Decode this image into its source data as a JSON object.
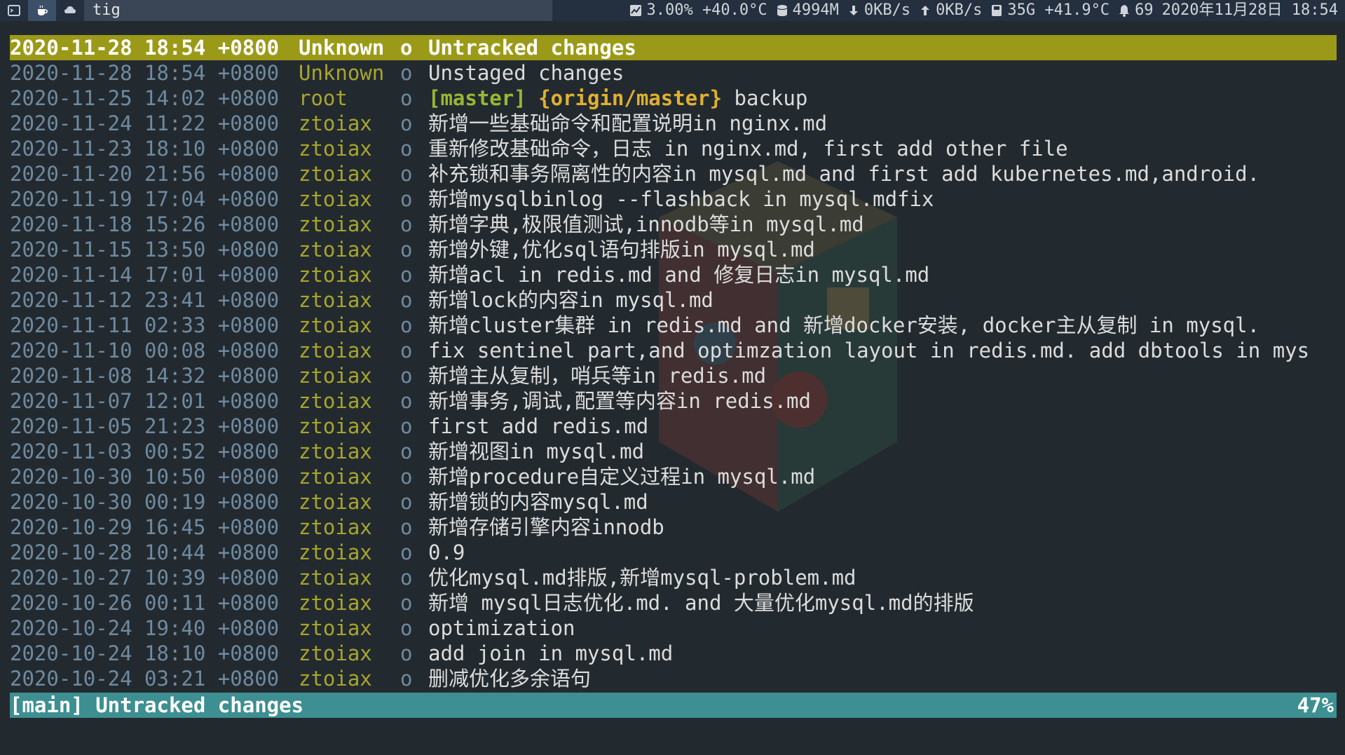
{
  "topbar": {
    "workspaces": [
      {
        "icon": "terminal-icon",
        "active": false
      },
      {
        "icon": "coffee-icon",
        "active": true
      },
      {
        "icon": "cloud-icon",
        "active": false
      }
    ],
    "window_title": "tig",
    "cpu": "3.00% +40.0°C",
    "memory": "4994M",
    "download": "0KB/s",
    "upload": "0KB/s",
    "disk": "35G +41.9°C",
    "notifications": "69",
    "datetime": "2020年11月28日 18:54"
  },
  "log": {
    "rows": [
      {
        "date": "2020-11-28 18:54 +0800",
        "author": "Unknown",
        "node": "o",
        "branch": "",
        "remote": "",
        "message": "Untracked changes",
        "selected": true
      },
      {
        "date": "2020-11-28 18:54 +0800",
        "author": "Unknown",
        "node": "o",
        "branch": "",
        "remote": "",
        "message": "Unstaged changes"
      },
      {
        "date": "2020-11-25 14:02 +0800",
        "author": "root",
        "node": "o",
        "branch": "[master]",
        "remote": "{origin/master}",
        "message": "backup"
      },
      {
        "date": "2020-11-24 11:22 +0800",
        "author": "ztoiax",
        "node": "o",
        "branch": "",
        "remote": "",
        "message": "新增一些基础命令和配置说明in nginx.md"
      },
      {
        "date": "2020-11-23 18:10 +0800",
        "author": "ztoiax",
        "node": "o",
        "branch": "",
        "remote": "",
        "message": "重新修改基础命令，日志 in nginx.md, first add other file"
      },
      {
        "date": "2020-11-20 21:56 +0800",
        "author": "ztoiax",
        "node": "o",
        "branch": "",
        "remote": "",
        "message": "补充锁和事务隔离性的内容in mysql.md and first add kubernetes.md,android."
      },
      {
        "date": "2020-11-19 17:04 +0800",
        "author": "ztoiax",
        "node": "o",
        "branch": "",
        "remote": "",
        "message": "新增mysqlbinlog --flashback in mysql.mdfix"
      },
      {
        "date": "2020-11-18 15:26 +0800",
        "author": "ztoiax",
        "node": "o",
        "branch": "",
        "remote": "",
        "message": "新增字典,极限值测试,innodb等in mysql.md"
      },
      {
        "date": "2020-11-15 13:50 +0800",
        "author": "ztoiax",
        "node": "o",
        "branch": "",
        "remote": "",
        "message": "新增外键,优化sql语句排版in mysql.md"
      },
      {
        "date": "2020-11-14 17:01 +0800",
        "author": "ztoiax",
        "node": "o",
        "branch": "",
        "remote": "",
        "message": "新增acl in redis.md and 修复日志in mysql.md"
      },
      {
        "date": "2020-11-12 23:41 +0800",
        "author": "ztoiax",
        "node": "o",
        "branch": "",
        "remote": "",
        "message": "新增lock的内容in mysql.md"
      },
      {
        "date": "2020-11-11 02:33 +0800",
        "author": "ztoiax",
        "node": "o",
        "branch": "",
        "remote": "",
        "message": "新增cluster集群 in redis.md and 新增docker安装, docker主从复制 in mysql."
      },
      {
        "date": "2020-11-10 00:08 +0800",
        "author": "ztoiax",
        "node": "o",
        "branch": "",
        "remote": "",
        "message": "fix sentinel part,and optimzation layout in redis.md. add dbtools in mys"
      },
      {
        "date": "2020-11-08 14:32 +0800",
        "author": "ztoiax",
        "node": "o",
        "branch": "",
        "remote": "",
        "message": "新增主从复制，哨兵等in redis.md"
      },
      {
        "date": "2020-11-07 12:01 +0800",
        "author": "ztoiax",
        "node": "o",
        "branch": "",
        "remote": "",
        "message": "新增事务,调试,配置等内容in redis.md"
      },
      {
        "date": "2020-11-05 21:23 +0800",
        "author": "ztoiax",
        "node": "o",
        "branch": "",
        "remote": "",
        "message": "first add redis.md"
      },
      {
        "date": "2020-11-03 00:52 +0800",
        "author": "ztoiax",
        "node": "o",
        "branch": "",
        "remote": "",
        "message": "新增视图in mysql.md"
      },
      {
        "date": "2020-10-30 10:50 +0800",
        "author": "ztoiax",
        "node": "o",
        "branch": "",
        "remote": "",
        "message": "新增procedure自定义过程in mysql.md"
      },
      {
        "date": "2020-10-30 00:19 +0800",
        "author": "ztoiax",
        "node": "o",
        "branch": "",
        "remote": "",
        "message": "新增锁的内容mysql.md"
      },
      {
        "date": "2020-10-29 16:45 +0800",
        "author": "ztoiax",
        "node": "o",
        "branch": "",
        "remote": "",
        "message": "新增存储引擎内容innodb"
      },
      {
        "date": "2020-10-28 10:44 +0800",
        "author": "ztoiax",
        "node": "o",
        "branch": "",
        "remote": "",
        "message": "0.9"
      },
      {
        "date": "2020-10-27 10:39 +0800",
        "author": "ztoiax",
        "node": "o",
        "branch": "",
        "remote": "",
        "message": "优化mysql.md排版,新增mysql-problem.md"
      },
      {
        "date": "2020-10-26 00:11 +0800",
        "author": "ztoiax",
        "node": "o",
        "branch": "",
        "remote": "",
        "message": "新增 mysql日志优化.md. and 大量优化mysql.md的排版"
      },
      {
        "date": "2020-10-24 19:40 +0800",
        "author": "ztoiax",
        "node": "o",
        "branch": "",
        "remote": "",
        "message": "optimization"
      },
      {
        "date": "2020-10-24 18:10 +0800",
        "author": "ztoiax",
        "node": "o",
        "branch": "",
        "remote": "",
        "message": "add join in mysql.md"
      },
      {
        "date": "2020-10-24 03:21 +0800",
        "author": "ztoiax",
        "node": "o",
        "branch": "",
        "remote": "",
        "message": "删减优化多余语句"
      }
    ]
  },
  "status": {
    "view": "[main] Untracked changes",
    "percent": "47%"
  },
  "colors": {
    "selected_bg": "#9b9a18",
    "status_bg": "#3d8f91",
    "date": "#6e8aa0",
    "author": "#a7a52e",
    "branch": "#97b832",
    "remote": "#e0b030"
  }
}
